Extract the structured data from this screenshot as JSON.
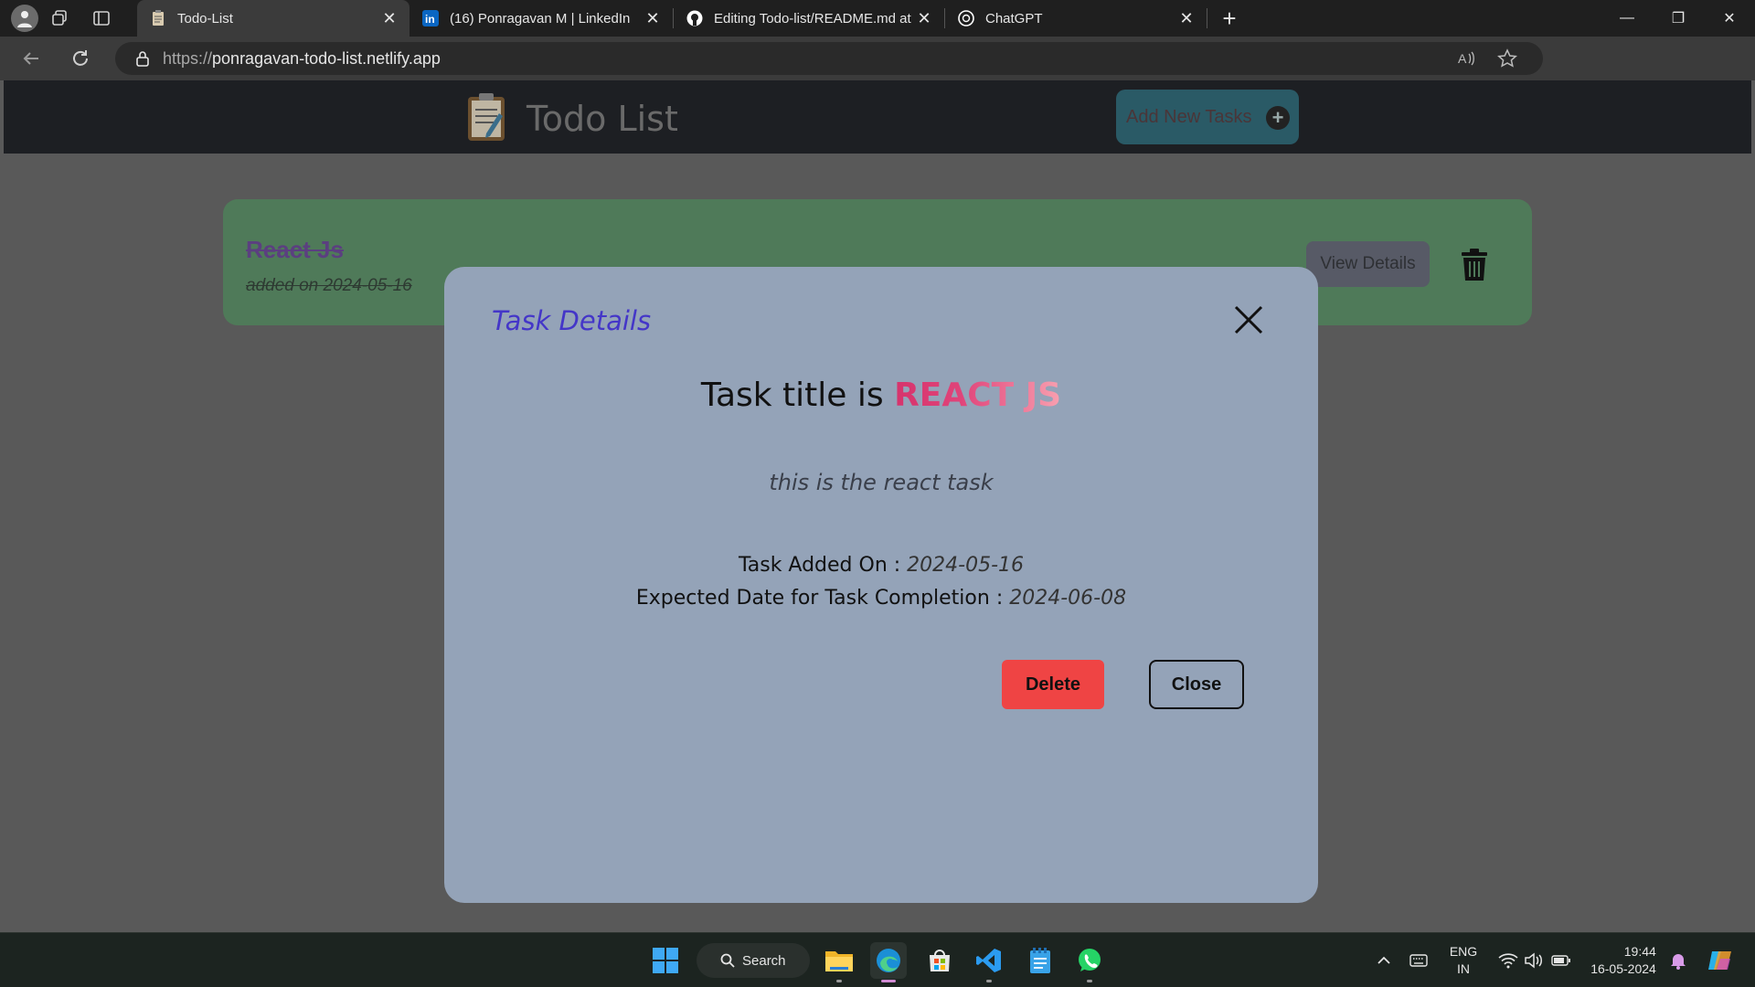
{
  "browser": {
    "tabs": [
      {
        "title": "Todo-List",
        "icon": "notepad-favicon",
        "active": true
      },
      {
        "title": "(16) Ponragavan M | LinkedIn",
        "icon": "linkedin-favicon",
        "active": false
      },
      {
        "title": "Editing Todo-list/README.md at",
        "icon": "github-favicon",
        "active": false
      },
      {
        "title": "ChatGPT",
        "icon": "chatgpt-favicon",
        "active": false
      }
    ],
    "url_protocol": "https://",
    "url_host": "ponragavan-todo-list.netlify.app"
  },
  "app": {
    "title": "Todo List",
    "add_button_label": "Add New Tasks",
    "task": {
      "title": "React Js",
      "date_label": "added on 2024-05-16",
      "view_details_label": "View Details"
    }
  },
  "modal": {
    "heading": "Task Details",
    "title_prefix": "Task title is ",
    "title_value": "REACT JS",
    "description": "this is the react task",
    "added_label": "Task Added On : ",
    "added_value": "2024-05-16",
    "expected_label": "Expected Date for Task Completion : ",
    "expected_value": "2024-06-08",
    "delete_label": "Delete",
    "close_label": "Close"
  },
  "taskbar": {
    "search_label": "Search",
    "lang_line1": "ENG",
    "lang_line2": "IN",
    "time": "19:44",
    "date": "16-05-2024"
  },
  "colors": {
    "modal_bg": "#94a3b8",
    "heading": "#4436c8",
    "delete_btn": "#ef4444",
    "task_card": "#4f7a59"
  }
}
